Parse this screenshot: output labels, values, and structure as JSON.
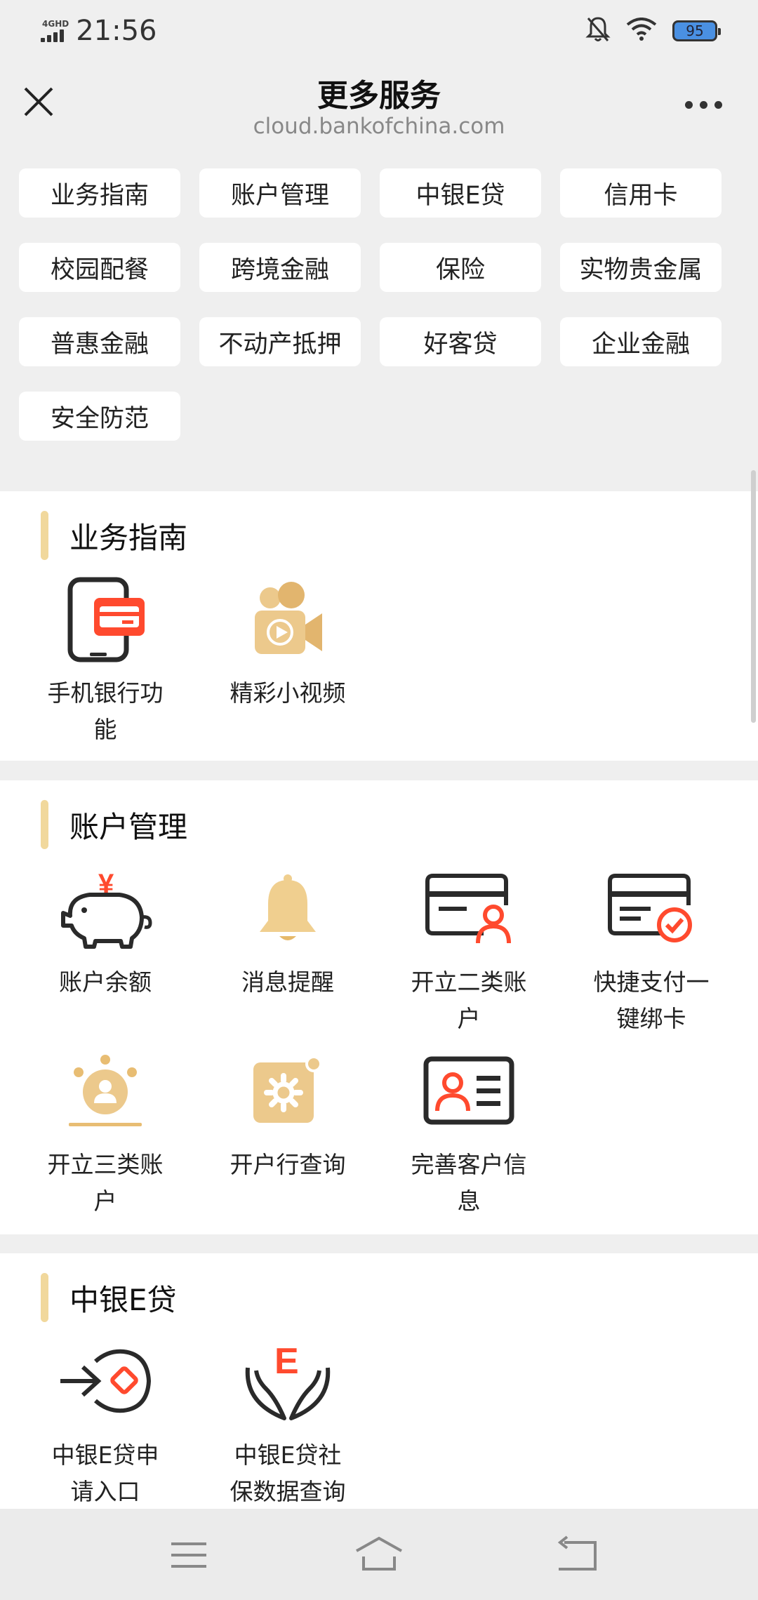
{
  "status_bar": {
    "network": "4GHD",
    "time": "21:56",
    "battery": "95"
  },
  "nav": {
    "title": "更多服务",
    "url": "cloud.bankofchina.com"
  },
  "tags": [
    "业务指南",
    "账户管理",
    "中银E贷",
    "信用卡",
    "校园配餐",
    "跨境金融",
    "保险",
    "实物贵金属",
    "普惠金融",
    "不动产抵押",
    "好客贷",
    "企业金融",
    "安全防范"
  ],
  "sections": [
    {
      "title": "业务指南",
      "items": [
        {
          "label": "手机银行功能",
          "icon": "mobile-card-icon"
        },
        {
          "label": "精彩小视频",
          "icon": "video-camera-icon"
        }
      ]
    },
    {
      "title": "账户管理",
      "items": [
        {
          "label": "账户余额",
          "icon": "piggy-bank-icon"
        },
        {
          "label": "消息提醒",
          "icon": "bell-icon"
        },
        {
          "label": "开立二类账户",
          "icon": "card-user-icon"
        },
        {
          "label": "快捷支付一键绑卡",
          "icon": "card-check-icon"
        },
        {
          "label": "开立三类账户",
          "icon": "user-badge-icon"
        },
        {
          "label": "开户行查询",
          "icon": "gear-icon"
        },
        {
          "label": "完善客户信息",
          "icon": "id-card-icon"
        }
      ]
    },
    {
      "title": "中银E贷",
      "items": [
        {
          "label": "中银E贷申请入口",
          "icon": "arrow-coin-icon"
        },
        {
          "label": "中银E贷社保数据查询",
          "icon": "hands-e-icon"
        }
      ]
    }
  ],
  "colors": {
    "accent_red": "#ff4a2e",
    "gold": "#e9c27a",
    "section_bar": "#f1d89c"
  }
}
